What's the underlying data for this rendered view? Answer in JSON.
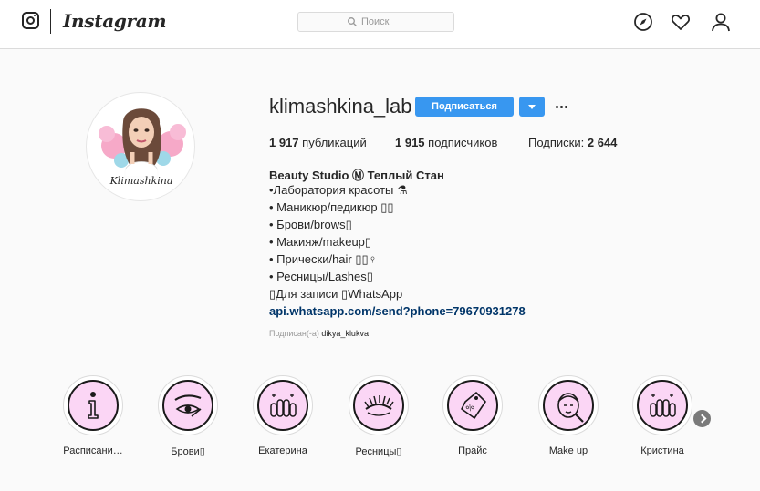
{
  "header": {
    "brand": "Instagram",
    "search_placeholder": "Поиск",
    "icons": [
      "instagram-glyph-icon",
      "explore-compass-icon",
      "activity-heart-icon",
      "profile-person-icon",
      "search-icon"
    ]
  },
  "profile": {
    "username": "klimashkina_lab",
    "avatar_text": "Klimashkina",
    "follow_label": "Подписаться",
    "stats": {
      "posts_count": "1 917",
      "posts_label": "публикаций",
      "followers_count": "1 915",
      "followers_label": "подписчиков",
      "following_label": "Подписки:",
      "following_count": "2 644"
    },
    "bio": {
      "name": "Beauty Studio Ⓜ Теплый Стан",
      "lines": [
        "•Лаборатория красоты ⚗",
        "• Маникюр/педикюр ▯▯",
        "• Брови/brows▯",
        "• Макияж/makeup▯",
        "• Прически/hair ▯▯♀",
        "• Ресницы/Lashes▯",
        "▯Для записи ▯WhatsApp"
      ],
      "link": "api.whatsapp.com/send?phone=79670931278"
    },
    "followed_by_label": "Подписан(-а)",
    "followed_by_user": "dikya_klukva"
  },
  "highlights": [
    {
      "label": "Расписани…",
      "icon": "info-icon"
    },
    {
      "label": "Брови▯",
      "icon": "eyebrow-icon"
    },
    {
      "label": "Екатерина",
      "icon": "nails-icon"
    },
    {
      "label": "Ресницы▯",
      "icon": "eyelashes-icon"
    },
    {
      "label": "Прайс",
      "icon": "price-tag-icon"
    },
    {
      "label": "Make up",
      "icon": "face-makeup-icon"
    },
    {
      "label": "Кристина",
      "icon": "nails-icon"
    }
  ],
  "colors": {
    "accent": "#3897f0",
    "link": "#003569",
    "highlight_fill": "#fbd6f5",
    "border": "#dbdbdb"
  }
}
